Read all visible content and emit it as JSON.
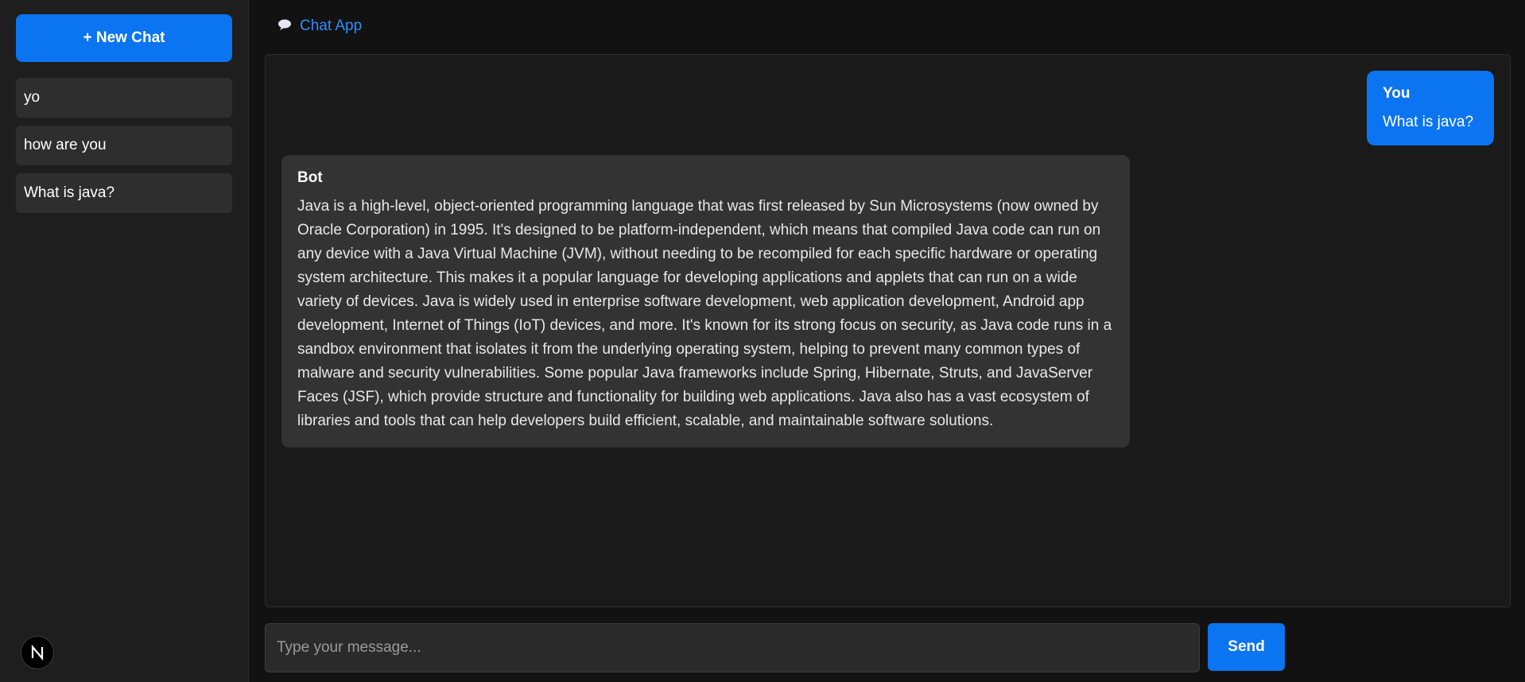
{
  "sidebar": {
    "new_chat_label": "+ New Chat",
    "history": [
      {
        "label": "yo"
      },
      {
        "label": "how are you"
      },
      {
        "label": "What is java?"
      }
    ],
    "badge_letter": "N"
  },
  "header": {
    "icon": "speech-bubble-icon",
    "title": "Chat App"
  },
  "messages": {
    "user": {
      "author": "You",
      "text": "What is java?"
    },
    "bot": {
      "author": "Bot",
      "text": "Java is a high-level, object-oriented programming language that was first released by Sun Microsystems (now owned by Oracle Corporation) in 1995. It's designed to be platform-independent, which means that compiled Java code can run on any device with a Java Virtual Machine (JVM), without needing to be recompiled for each specific hardware or operating system architecture. This makes it a popular language for developing applications and applets that can run on a wide variety of devices. Java is widely used in enterprise software development, web application development, Android app development, Internet of Things (IoT) devices, and more. It's known for its strong focus on security, as Java code runs in a sandbox environment that isolates it from the underlying operating system, helping to prevent many common types of malware and security vulnerabilities. Some popular Java frameworks include Spring, Hibernate, Struts, and JavaServer Faces (JSF), which provide structure and functionality for building web applications. Java also has a vast ecosystem of libraries and tools that can help developers build efficient, scalable, and maintainable software solutions."
    }
  },
  "composer": {
    "placeholder": "Type your message...",
    "value": "",
    "send_label": "Send"
  },
  "colors": {
    "accent": "#0b74f0",
    "link": "#2d8cff",
    "background": "#121212",
    "sidebar": "#1e1e1e",
    "bot_bubble": "#333333"
  }
}
